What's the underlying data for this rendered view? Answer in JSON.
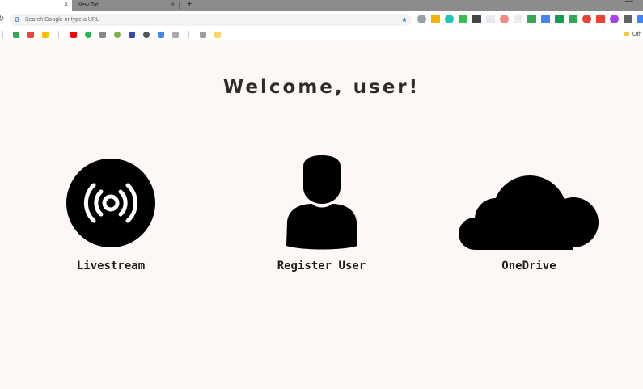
{
  "browser": {
    "tabs": [
      {
        "label": "",
        "active": true
      },
      {
        "label": "New Tab",
        "active": false
      }
    ],
    "new_tab_glyph": "+",
    "close_glyph": "×",
    "omnibox": {
      "placeholder": "Search Google or type a URL"
    },
    "bookmarks_other_label": "Oth"
  },
  "page": {
    "title": "Welcome, user!",
    "tiles": [
      {
        "label": "Livestream",
        "icon": "broadcast-icon"
      },
      {
        "label": "Register User",
        "icon": "user-icon"
      },
      {
        "label": "OneDrive",
        "icon": "cloud-icon"
      }
    ]
  },
  "colors": {
    "background": "#fdf8f6",
    "title": "#2e2c2b",
    "icon": "#000000"
  }
}
